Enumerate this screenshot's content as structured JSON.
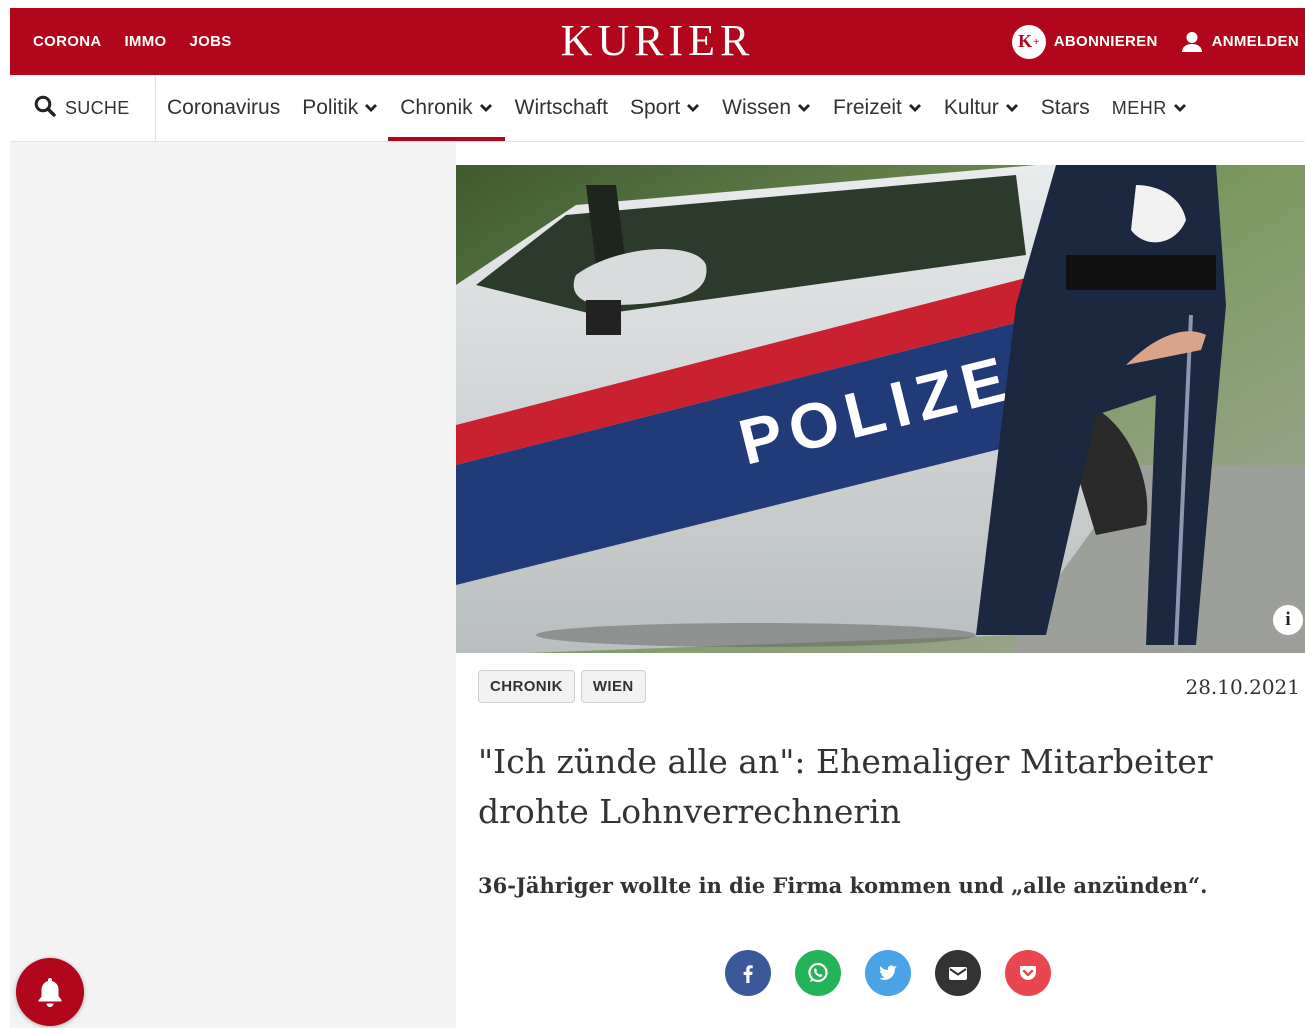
{
  "topbar": {
    "links": [
      "CORONA",
      "IMMO",
      "JOBS"
    ],
    "logo": "KURIER",
    "kplus_letter": "K",
    "kplus_sup": "+",
    "subscribe_label": "ABONNIEREN",
    "login_label": "ANMELDEN"
  },
  "nav": {
    "search_label": "SUCHE",
    "items": [
      {
        "label": "Coronavirus",
        "dropdown": false
      },
      {
        "label": "Politik",
        "dropdown": true
      },
      {
        "label": "Chronik",
        "dropdown": true,
        "active": true
      },
      {
        "label": "Wirtschaft",
        "dropdown": false
      },
      {
        "label": "Sport",
        "dropdown": true
      },
      {
        "label": "Wissen",
        "dropdown": true
      },
      {
        "label": "Freizeit",
        "dropdown": true
      },
      {
        "label": "Kultur",
        "dropdown": true
      },
      {
        "label": "Stars",
        "dropdown": false
      }
    ],
    "more_label": "MEHR"
  },
  "article": {
    "hero_car_text": "POLIZEI",
    "info_icon": "i",
    "tags": [
      "CHRONIK",
      "WIEN"
    ],
    "date": "28.10.2021",
    "headline": "\"Ich zünde alle an\": Ehemaliger Mitarbeiter drohte Lohnverrechnerin",
    "lead": "36-Jähriger wollte in die Firma kommen und „alle anzünden“."
  },
  "share": [
    {
      "icon": "facebook-icon",
      "color": "#3b5998"
    },
    {
      "icon": "whatsapp-icon",
      "color": "#25b35a"
    },
    {
      "icon": "twitter-icon",
      "color": "#4aa3e6"
    },
    {
      "icon": "email-icon",
      "color": "#333333"
    },
    {
      "icon": "pocket-icon",
      "color": "#e8474f"
    }
  ],
  "colors": {
    "brand_red": "#b1061b",
    "text": "#333333"
  },
  "notification_icon": "bell-icon"
}
